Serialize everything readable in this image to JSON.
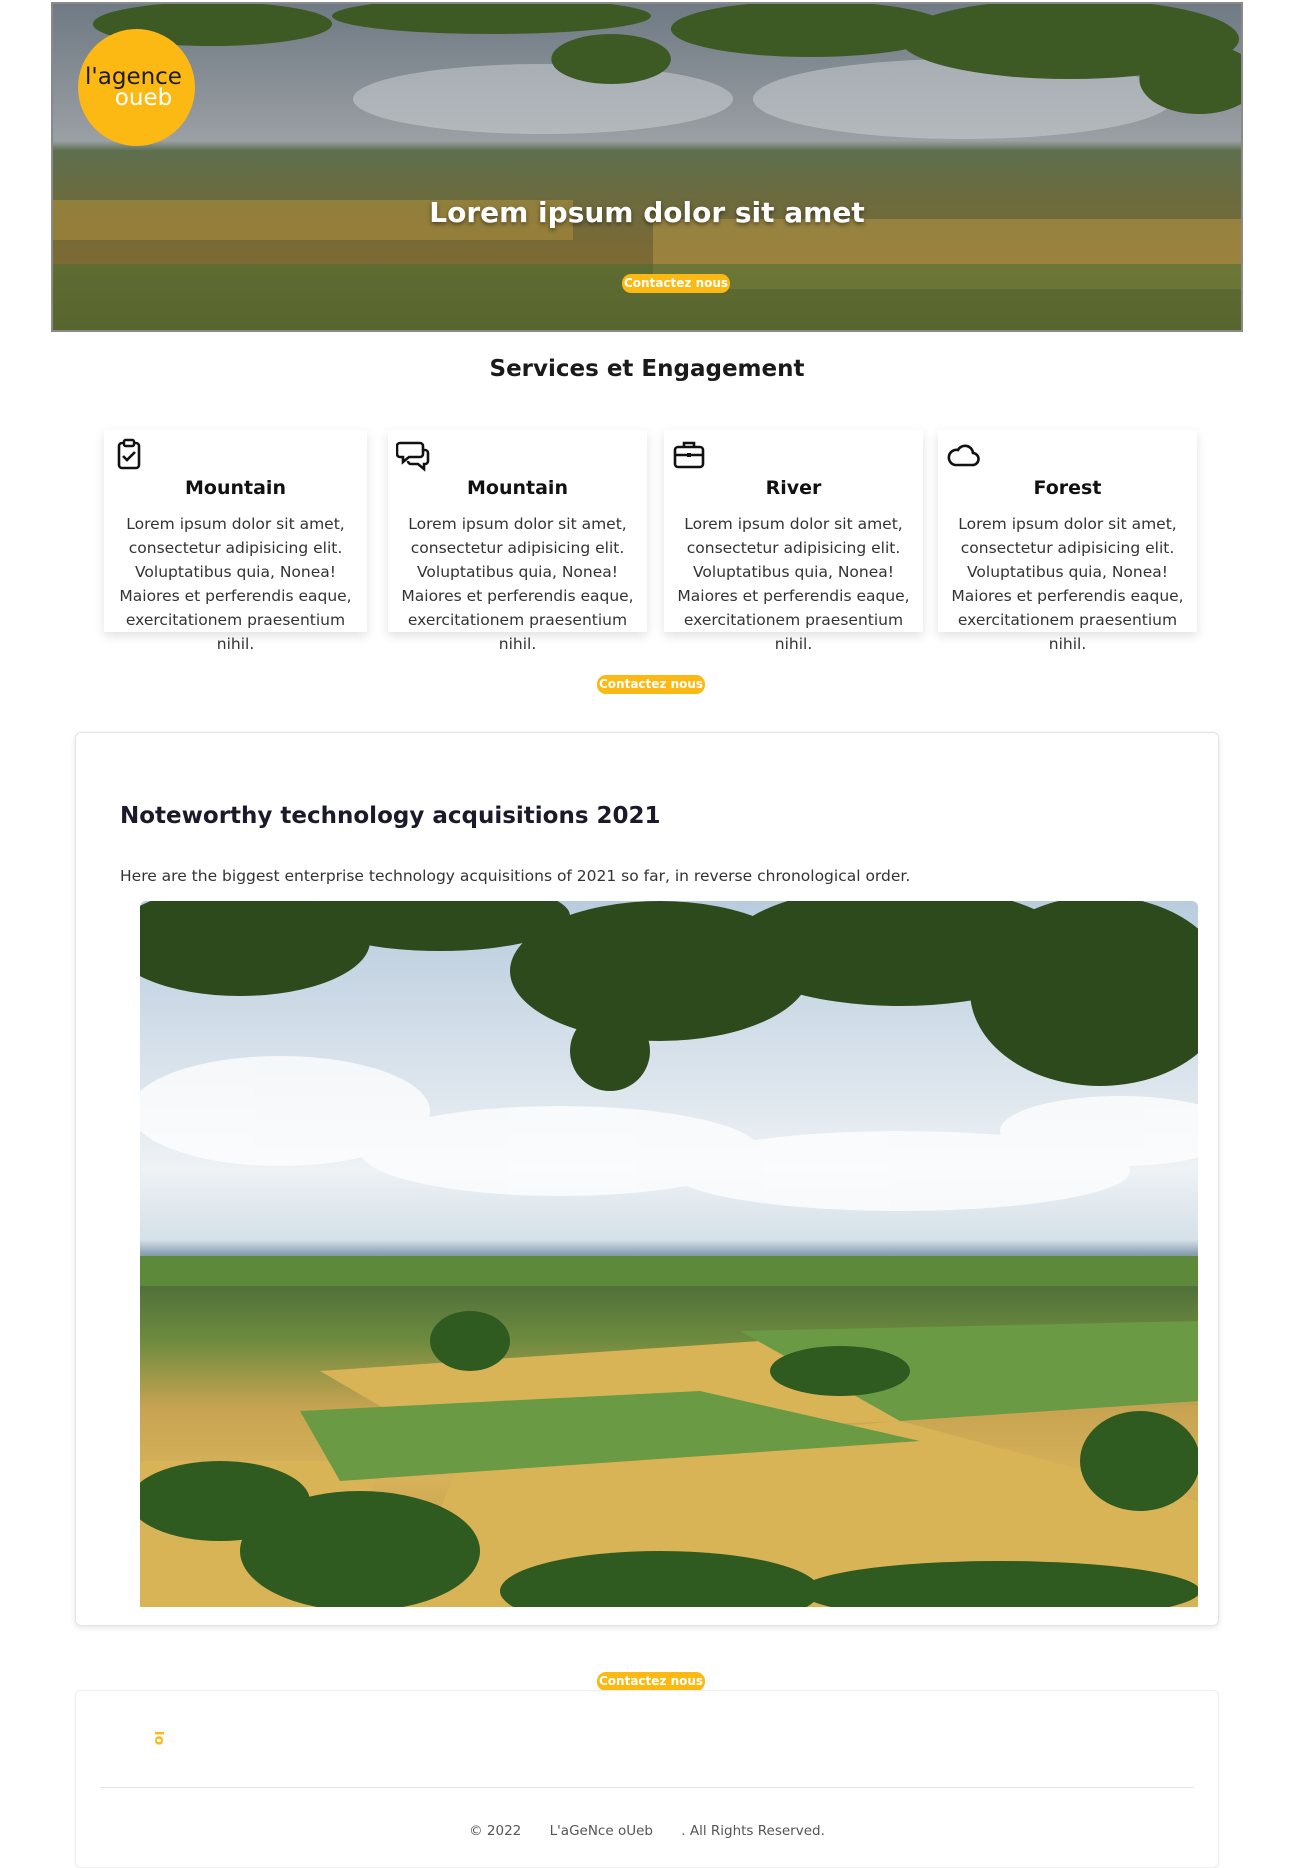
{
  "hero": {
    "logo_line1": "l'agence",
    "logo_line2": "oueb",
    "title": "Lorem ipsum dolor sit amet",
    "button_label": "Contactez nous"
  },
  "services": {
    "title": "Services et Engagement",
    "cards": [
      {
        "icon": "clipboard-check-icon",
        "title": "Mountain",
        "text": "Lorem ipsum dolor sit amet, consectetur adipisicing elit. Voluptatibus quia, Nonea! Maiores et perferendis eaque, exercitationem praesentium nihil."
      },
      {
        "icon": "chat-bubbles-icon",
        "title": "Mountain",
        "text": "Lorem ipsum dolor sit amet, consectetur adipisicing elit. Voluptatibus quia, Nonea! Maiores et perferendis eaque, exercitationem praesentium nihil."
      },
      {
        "icon": "briefcase-icon",
        "title": "River",
        "text": "Lorem ipsum dolor sit amet, consectetur adipisicing elit. Voluptatibus quia, Nonea! Maiores et perferendis eaque, exercitationem praesentium nihil."
      },
      {
        "icon": "cloud-icon",
        "title": "Forest",
        "text": "Lorem ipsum dolor sit amet, consectetur adipisicing elit. Voluptatibus quia, Nonea! Maiores et perferendis eaque, exercitationem praesentium nihil."
      }
    ],
    "button_label": "Contactez nous"
  },
  "article": {
    "title": "Noteworthy technology acquisitions 2021",
    "text": "Here are the biggest enterprise technology acquisitions of 2021 so far, in reverse chronological order.",
    "button_label": "Contactez nous"
  },
  "footer": {
    "year": "© 2022",
    "brand": "L'aGeNce oUeb",
    "rights": ". All Rights Reserved."
  },
  "colors": {
    "accent": "#fcb813",
    "text": "#333333"
  }
}
